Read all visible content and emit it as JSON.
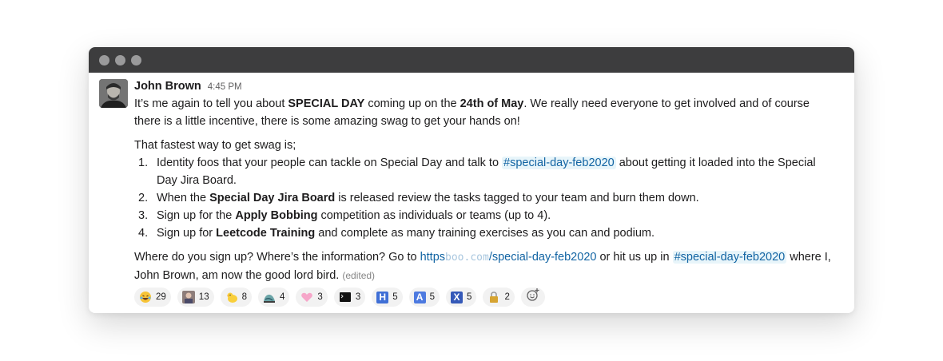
{
  "message": {
    "author": "John Brown",
    "time": "4:45 PM",
    "para1": {
      "t1": "It’s me again to tell you about ",
      "b1": "SPECIAL DAY",
      "t2": " coming up on the ",
      "b2": "24th of May",
      "t3": ". We really need everyone to get involved and of course there is a little incentive, there is some amazing swag to get your hands on!"
    },
    "intro": "That fastest way to get swag is;",
    "steps": [
      {
        "num": "1.",
        "t1": "Identity foos that your people can tackle on Special Day and talk to ",
        "channel": "#special-day-feb2020",
        "t2": " about getting it loaded into the Special Day Jira Board."
      },
      {
        "num": "2.",
        "t1": "When the ",
        "b": "Special Day Jira Board",
        "t2": " is released review the tasks tagged to your team and burn them down."
      },
      {
        "num": "3.",
        "t1": "Sign up for the ",
        "b": "Apply Bobbing",
        "t2": " competition as individuals or teams (up to 4)."
      },
      {
        "num": "4.",
        "t1": "Sign up for ",
        "b": "Leetcode Training",
        "t2": " and complete as many training exercises as you can and podium."
      }
    ],
    "closing": {
      "t1": "Where do you sign up? Where’s the information? Go to ",
      "link_a": "https",
      "link_b": "boo.com",
      "link_c": "/special-day-feb2020",
      "t2": " or hit us up in ",
      "channel": "#special-day-feb2020",
      "t3": " where I, John Brown, am now the good lord bird.",
      "edited": "(edited)"
    },
    "reactions": [
      {
        "icon": "laughing-emoji-icon",
        "count": "29"
      },
      {
        "icon": "person-avatar-emoji-icon",
        "count": "13"
      },
      {
        "icon": "chick-emoji-icon",
        "count": "8"
      },
      {
        "icon": "wave-shoe-emoji-icon",
        "count": "4"
      },
      {
        "icon": "pink-heart-emoji-icon",
        "count": "3"
      },
      {
        "icon": "terminal-emoji-icon",
        "count": "3"
      },
      {
        "icon": "letter-h-emoji-icon",
        "count": "5",
        "letter": "H"
      },
      {
        "icon": "letter-a-emoji-icon",
        "count": "5",
        "letter": "A"
      },
      {
        "icon": "letter-x-emoji-icon",
        "count": "5",
        "letter": "X"
      },
      {
        "icon": "padlock-emoji-icon",
        "count": "2"
      }
    ]
  },
  "colors": {
    "titlebar": "#3d3d3e",
    "link": "#1264a3",
    "reaction_bg": "#f2f2f2"
  }
}
